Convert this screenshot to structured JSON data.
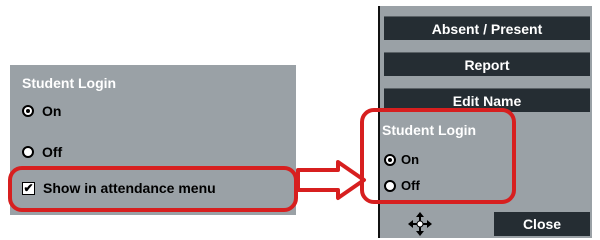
{
  "left_panel": {
    "title": "Student Login",
    "options": [
      {
        "label": "On",
        "selected": true
      },
      {
        "label": "Off",
        "selected": false
      }
    ],
    "checkbox": {
      "label": "Show in attendance menu",
      "checked": true,
      "mark": "✔"
    }
  },
  "right_panel": {
    "menu_buttons": [
      "Absent / Present",
      "Report",
      "Edit Name"
    ],
    "title": "Student Login",
    "options": [
      {
        "label": "On",
        "selected": true
      },
      {
        "label": "Off",
        "selected": false
      }
    ],
    "close_label": "Close",
    "move_icon": "move-icon"
  },
  "colors": {
    "panel_bg": "#9aa1a6",
    "button_bg": "#252d33",
    "highlight_red": "#d71f1f"
  }
}
